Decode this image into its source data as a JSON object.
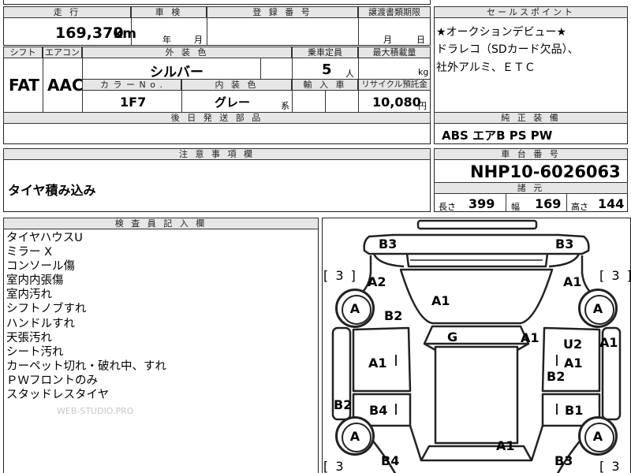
{
  "header": {
    "mileage_label": "走 行",
    "inspection_label": "車 検",
    "registration_label": "登 録 番 号",
    "transfer_deadline_label": "譲渡書類期限",
    "mileage_value": "169,370",
    "mileage_unit": "km",
    "inspection_year_unit": "年",
    "inspection_month_unit": "月",
    "deadline_month_unit": "月",
    "deadline_day_unit": "日"
  },
  "row2": {
    "shift_label": "シフト",
    "ac_label": "エアコン",
    "exterior_color_label": "外 装 色",
    "capacity_label": "乗車定員",
    "max_load_label": "最大積載量",
    "shift_value": "FAT",
    "ac_value": "AAC",
    "exterior_color_value": "シルバー",
    "capacity_value": "5",
    "capacity_unit": "人",
    "max_load_unit": "kg",
    "color_no_label": "カ ラ ー  N o .",
    "interior_color_label": "内 装 色",
    "import_label": "輸 入 車",
    "recycle_label": "リサイクル預託金",
    "color_no_value": "1F7",
    "interior_color_value": "グレー",
    "interior_suffix": "系",
    "recycle_value": "10,080",
    "recycle_unit": "円"
  },
  "later_parts": {
    "label": "後 日 発 送 部 品"
  },
  "notes": {
    "label": "注 意 事 項 欄",
    "text": "タイヤ積み込み"
  },
  "sales_points": {
    "label": "セールスポイント",
    "lines": [
      "★オークションデビュー★",
      "ドラレコ（SDカード欠品）、",
      "社外アルミ、ＥＴＣ"
    ]
  },
  "standard_equipment": {
    "label": "純 正 装 備",
    "value": "ABS エアB PS PW"
  },
  "chassis": {
    "label": "車 台 番 号",
    "value": "NHP10-6026063"
  },
  "specs": {
    "label": "諸 元",
    "length_label": "長さ",
    "length_value": "399",
    "width_label": "幅",
    "width_value": "169",
    "height_label": "高さ",
    "height_value": "144"
  },
  "inspector": {
    "label": "検 査 員 記 入 欄",
    "lines": [
      "タイヤハウスU",
      "ミラー X",
      "コンソール傷",
      "室内内張傷",
      "室内汚れ",
      "シフトノブすれ",
      "ハンドルすれ",
      "天張汚れ",
      "シート汚れ",
      "カーペット切れ・破れ中、すれ",
      "ＰＷフロントのみ",
      "スタッドレスタイヤ"
    ],
    "watermark": "WEB-STUDIO.PRO"
  },
  "diagram": {
    "tread_left_top": "[ 3 ]",
    "tread_right_top": "[ 3 ]",
    "tread_left_bottom": "[ 3",
    "tread_right_bottom": "[ 3",
    "tire_label": "A",
    "marks": {
      "b3_top_left": "B3",
      "b3_top_right": "B3",
      "a2": "A2",
      "a1_top_right": "A1",
      "a1_hood": "A1",
      "b2_left": "B2",
      "g": "G",
      "a1_windshield": "A1",
      "u2": "U2",
      "a1_far_right": "A1",
      "a1_left_door": "A1",
      "a1_right_door": "A1",
      "b2_right": "B2",
      "b2_left_lower": "B2",
      "b4_left": "B4",
      "b1_right": "B1",
      "a1_rear": "A1",
      "b4_bottom": "B4",
      "b3_bottom_right": "B3"
    }
  }
}
